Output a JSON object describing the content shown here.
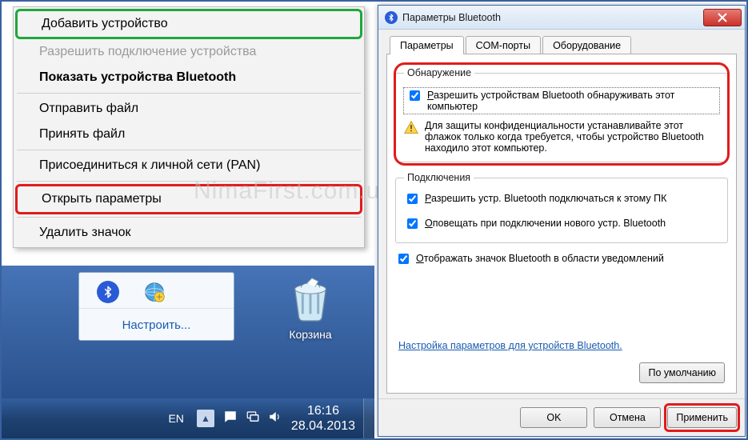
{
  "context_menu": {
    "add_device": "Добавить устройство",
    "allow_connection": "Разрешить подключение устройства",
    "show_devices": "Показать устройства Bluetooth",
    "send_file": "Отправить файл",
    "receive_file": "Принять файл",
    "join_pan": "Присоединиться к личной сети (PAN)",
    "open_settings": "Открыть параметры",
    "remove_icon": "Удалить значок"
  },
  "tray": {
    "customize": "Настроить..."
  },
  "desktop": {
    "recycle_bin": "Корзина"
  },
  "taskbar": {
    "language": "EN",
    "time": "16:16",
    "date": "28.04.2013"
  },
  "dialog": {
    "title": "Параметры Bluetooth",
    "tabs": {
      "options": "Параметры",
      "com_ports": "COM-порты",
      "hardware": "Оборудование"
    },
    "discovery": {
      "legend": "Обнаружение",
      "allow_discover": "Разрешить устройствам Bluetooth обнаруживать этот компьютер",
      "warning": "Для защиты конфиденциальности устанавливайте этот флажок только когда требуется, чтобы устройство Bluetooth находило этот компьютер."
    },
    "connections": {
      "legend": "Подключения",
      "allow_connect": "Разрешить устр. Bluetooth подключаться к этому ПК",
      "notify_new": "Оповещать при подключении нового устр. Bluetooth"
    },
    "show_tray_icon": "Отображать значок Bluetooth в области уведомлений",
    "config_link": "Настройка параметров для устройств Bluetooth.",
    "defaults": "По умолчанию",
    "ok": "OK",
    "cancel": "Отмена",
    "apply": "Применить"
  },
  "watermark": "NimaFirst.com.ua"
}
